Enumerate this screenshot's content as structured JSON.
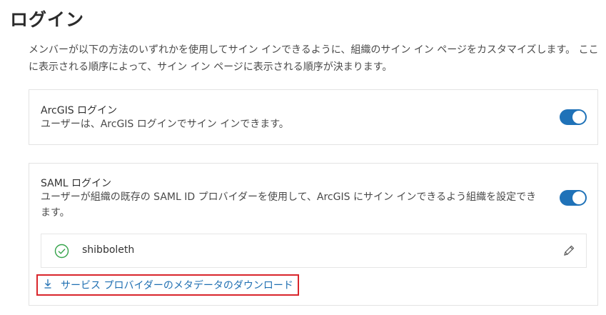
{
  "page": {
    "title": "ログイン",
    "description": "メンバーが以下の方法のいずれかを使用してサイン インできるように、組織のサイン イン ページをカスタマイズします。 ここに表示される順序によって、サイン イン ページに表示される順序が決まります。"
  },
  "arcgis_login": {
    "title": "ArcGIS ログイン",
    "description": "ユーザーは、ArcGIS ログインでサイン インできます。",
    "enabled": true
  },
  "saml_login": {
    "title": "SAML ログイン",
    "description": "ユーザーが組織の既存の SAML ID プロバイダーを使用して、ArcGIS にサイン インできるよう組織を設定できます。",
    "enabled": true,
    "provider_name": "shibboleth",
    "download_link": "サービス プロバイダーのメタデータのダウンロード"
  },
  "icons": {
    "provider_status": "check-circle-icon",
    "edit": "pencil-icon",
    "download": "download-icon"
  },
  "colors": {
    "toggle_on": "#1f72b8",
    "link": "#1f6fb2",
    "highlight_border": "#d9262c",
    "check": "#35a34a"
  }
}
